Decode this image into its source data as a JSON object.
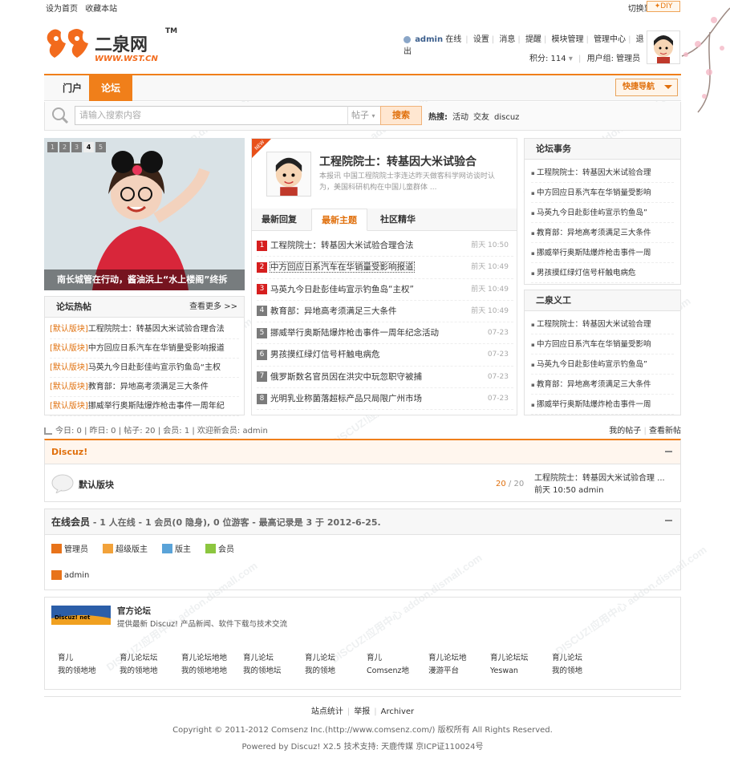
{
  "topbar": {
    "set_home": "设为首页",
    "bookmark": "收藏本站",
    "switch_wide": "切换到宽版",
    "diy": "✦DIY"
  },
  "logo": {
    "name": "二泉网",
    "tm": "TM",
    "url": "WWW.WST.CN"
  },
  "user": {
    "name": "admin",
    "status": "在线",
    "links": [
      "设置",
      "消息",
      "提醒",
      "模块管理",
      "管理中心",
      "退出"
    ],
    "points": "积分: 114",
    "group": "用户组: 管理员"
  },
  "nav": {
    "tabs": [
      "门户",
      "论坛"
    ],
    "quick": "快捷导航"
  },
  "search": {
    "placeholder": "请输入搜索内容",
    "select": "帖子",
    "button": "搜索",
    "hot_label": "热搜:",
    "hot": [
      "活动",
      "交友",
      "discuz"
    ]
  },
  "slider": {
    "pages": [
      "1",
      "2",
      "3",
      "4",
      "5"
    ],
    "caption": "南长城管在行动，酱油浜上“水上楼阁”终拆"
  },
  "hot_posts": {
    "title": "论坛热帖",
    "more": "查看更多 >>",
    "items": [
      {
        "tag": "[默认版块]",
        "text": "工程院院士：转基因大米试验合理合法"
      },
      {
        "tag": "[默认版块]",
        "text": "中方回应日系汽车在华销量受影响报道"
      },
      {
        "tag": "[默认版块]",
        "text": "马英九今日赴彭佳屿宣示钓鱼岛“主权"
      },
      {
        "tag": "[默认版块]",
        "text": "教育部：异地高考须满足三大条件"
      },
      {
        "tag": "[默认版块]",
        "text": "挪威举行奥斯陆爆炸枪击事件一周年纪"
      }
    ]
  },
  "featured": {
    "title": "工程院院士：转基因大米试验合",
    "desc": "本报讯 中国工程院院士李连达昨天做客科学网访谈时认为，美国科研机构在中国儿童群体 ..."
  },
  "center_tabs": [
    "最新回复",
    "最新主题",
    "社区精华"
  ],
  "threads": [
    {
      "n": "1",
      "title": "工程院院士：转基因大米试验合理合法",
      "time": "前天 10:50"
    },
    {
      "n": "2",
      "title": "中方回应日系汽车在华销量受影响报道",
      "time": "前天 10:49"
    },
    {
      "n": "3",
      "title": "马英九今日赴彭佳屿宣示钓鱼岛“主权”",
      "time": "前天 10:49"
    },
    {
      "n": "4",
      "title": "教育部：异地高考须满足三大条件",
      "time": "前天 10:49"
    },
    {
      "n": "5",
      "title": "挪威举行奥斯陆爆炸枪击事件一周年纪念活动",
      "time": "07-23"
    },
    {
      "n": "6",
      "title": "男孩摸红绿灯信号杆触电病危",
      "time": "07-23"
    },
    {
      "n": "7",
      "title": "俄罗斯数名官员因在洪灾中玩忽职守被捕",
      "time": "07-23"
    },
    {
      "n": "8",
      "title": "光明乳业称菌落超标产品只局限广州市场",
      "time": "07-23"
    }
  ],
  "affairs": {
    "title": "论坛事务",
    "items": [
      "工程院院士：转基因大米试验合理",
      "中方回应日系汽车在华销量受影响",
      "马英九今日赴彭佳屿宣示钓鱼岛”",
      "教育部：异地高考须满足三大条件",
      "挪威举行奥斯陆爆炸枪击事件一周",
      "男孩摸红绿灯信号杆触电病危"
    ]
  },
  "yigong": {
    "title": "二泉义工",
    "items": [
      "工程院院士：转基因大米试验合理",
      "中方回应日系汽车在华销量受影响",
      "马英九今日赴彭佳屿宣示钓鱼岛”",
      "教育部：异地高考须满足三大条件",
      "挪威举行奥斯陆爆炸枪击事件一周"
    ]
  },
  "stats": {
    "text": "今日: 0 | 昨日: 0 | 帖子: 20 | 会员: 1 | 欢迎新会员: admin",
    "my_posts": "我的帖子",
    "new_posts": "查看新帖"
  },
  "forum": {
    "category": "Discuz!",
    "name": "默认版块",
    "count_a": "20",
    "count_b": "/ 20",
    "last_title": "工程院院士：转基因大米试验合理 ...",
    "last_meta": "前天 10:50 admin"
  },
  "online": {
    "title": "在线会员",
    "detail": " - 1 人在线 - 1 会员(0 隐身), 0 位游客 - 最高记录是 3 于 2012-6-25.",
    "legend": [
      "管理员",
      "超级版主",
      "版主",
      "会员"
    ],
    "user": "admin"
  },
  "links": {
    "logo_text": "Discuz! net",
    "title": "官方论坛",
    "desc": "提供最新 Discuz! 产品新闻、软件下载与技术交流",
    "items": [
      [
        "育儿",
        "我的领地地"
      ],
      [
        "育儿论坛坛",
        "我的领地地"
      ],
      [
        "育儿论坛地地",
        "我的领地地地"
      ],
      [
        "育儿论坛",
        "我的领地坛"
      ],
      [
        "育儿论坛",
        "我的领地"
      ],
      [
        "育儿",
        "Comsenz地"
      ],
      [
        "育儿论坛地",
        "漫游平台"
      ],
      [
        "育儿论坛坛",
        "Yeswan"
      ],
      [
        "育儿论坛",
        "我的领地"
      ]
    ]
  },
  "footer": {
    "links": [
      "站点统计",
      "举报",
      "Archiver"
    ],
    "copyright": "Copyright © 2011-2012 Comsenz Inc.(http://www.comsenz.com/) 版权所有 All Rights Reserved.",
    "powered": "Powered by Discuz! X2.5  技术支持: 天鹿传媒 京ICP证110024号"
  },
  "colors": {
    "accent": "#f07f1a",
    "num_red": "#d61f1f",
    "num_gray": "#7b7b7b"
  }
}
